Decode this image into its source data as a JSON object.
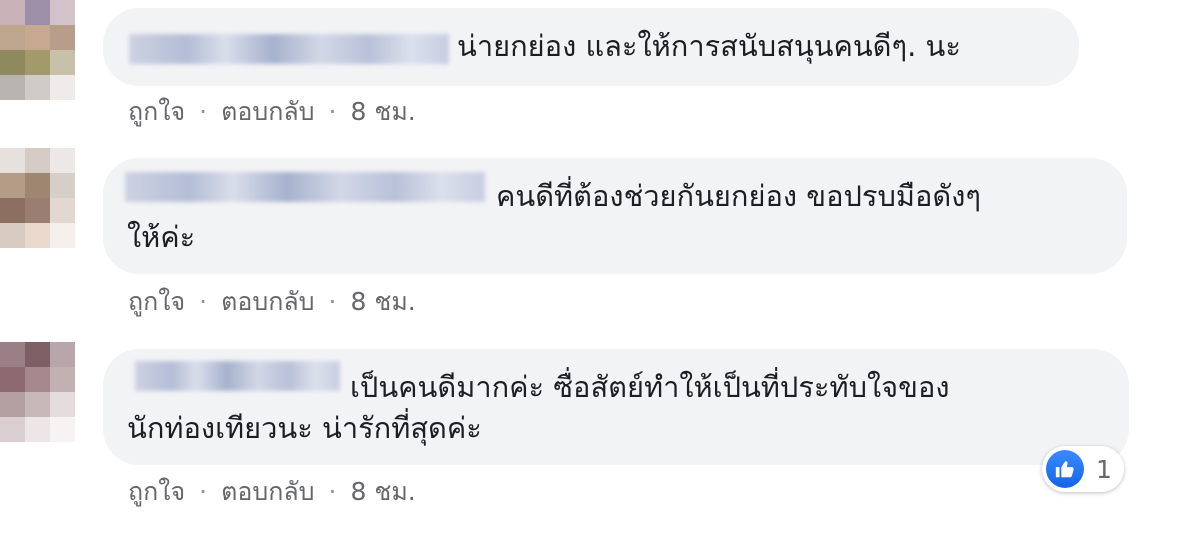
{
  "comments": [
    {
      "text_lines": [
        "น่ายกย่อง และให้การสนับสนุนคนดีๆ. นะ"
      ],
      "actions": {
        "like": "ถูกใจ",
        "reply": "ตอบกลับ",
        "time": "8 ชม."
      },
      "separator": "·"
    },
    {
      "text_lines": [
        "คนดีที่ต้องช่วยกันยกย่อง ขอปรบมือดังๆ",
        "ให้ค่ะ"
      ],
      "actions": {
        "like": "ถูกใจ",
        "reply": "ตอบกลับ",
        "time": "8 ชม."
      },
      "separator": "·"
    },
    {
      "text_lines": [
        "เป็นคนดีมากค่ะ ซื่อสัตย์ทำให้เป็นที่ประทับใจของ",
        "นักท่องเทียวนะ น่ารักที่สุดค่ะ"
      ],
      "actions": {
        "like": "ถูกใจ",
        "reply": "ตอบกลับ",
        "time": "8 ชม."
      },
      "separator": "·",
      "reactions": {
        "icon": "thumbs-up-icon",
        "count": "1",
        "color": "#1877f2"
      }
    }
  ]
}
